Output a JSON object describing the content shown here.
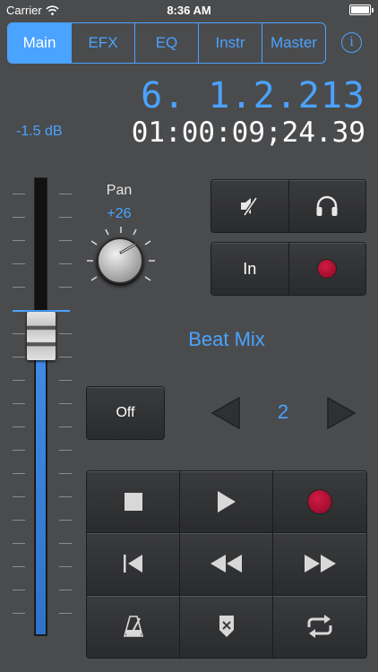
{
  "status_bar": {
    "carrier": "Carrier",
    "time": "8:36 AM"
  },
  "tabs": [
    {
      "label": "Main",
      "active": true
    },
    {
      "label": "EFX",
      "active": false
    },
    {
      "label": "EQ",
      "active": false
    },
    {
      "label": "Instr",
      "active": false
    },
    {
      "label": "Master",
      "active": false
    }
  ],
  "info_label": "i",
  "position": {
    "bars_beats": "6. 1.2.213",
    "smpte": "01:00:09;24.39"
  },
  "volume": {
    "label": "-1.5 dB",
    "level": 0.62
  },
  "pan": {
    "label": "Pan",
    "value": "+26"
  },
  "channel_buttons": {
    "mute_icon": "speaker-muted-icon",
    "solo_icon": "headphones-icon",
    "input_label": "In",
    "record_arm_icon": "record-icon"
  },
  "track_name": "Beat Mix",
  "toggle": {
    "label": "Off"
  },
  "pager": {
    "value": "2"
  },
  "transport": {
    "buttons": [
      "stop-icon",
      "play-icon",
      "record-icon",
      "go-to-start-icon",
      "rewind-icon",
      "fast-forward-icon",
      "metronome-icon",
      "count-in-icon",
      "cycle-icon"
    ]
  },
  "colors": {
    "accent": "#4aa3ff",
    "record": "#c8143c",
    "background": "#4a4b4d"
  }
}
